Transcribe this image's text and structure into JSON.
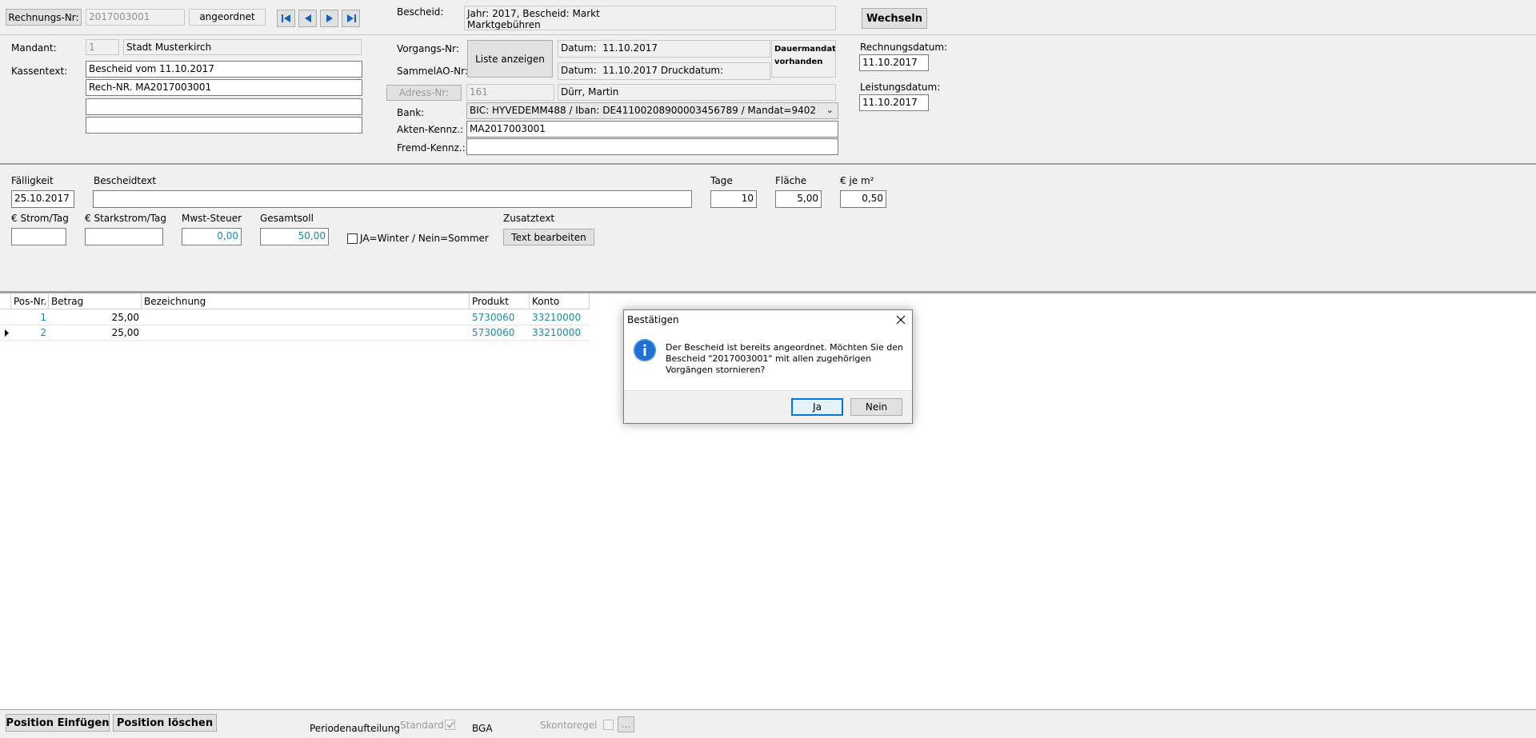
{
  "header": {
    "rechnungs_nr_button": "Rechnungs-Nr:",
    "rechnungs_nr_value": "2017003001",
    "status": "angeordnet",
    "bescheid_label": "Bescheid:",
    "bescheid_line1": "Jahr: 2017, Bescheid: Markt",
    "bescheid_line2": "Marktgebühren",
    "wechseln_button": "Wechseln"
  },
  "nav_icons": [
    "first-record-icon",
    "previous-record-icon",
    "next-record-icon",
    "last-record-icon"
  ],
  "left": {
    "mandant_label": "Mandant:",
    "mandant_nr": "1",
    "mandant_name": "Stadt Musterkirch",
    "kassentext_label": "Kassentext:",
    "kassentext_lines": [
      "Bescheid vom 11.10.2017",
      "Rech-NR. MA2017003001",
      "",
      ""
    ]
  },
  "middle": {
    "vorgangs_nr_label": "Vorgangs-Nr:",
    "sammelao_nr_label": "SammelAO-Nr:",
    "liste_anzeigen_button": "Liste anzeigen",
    "datum1_label": "Datum:",
    "datum1_value": "11.10.2017",
    "datum2_label": "Datum:",
    "datum2_value": "11.10.2017",
    "druckdatum_label": "Druckdatum:",
    "dauermandat_line1": "Dauermandat",
    "dauermandat_line2": "vorhanden",
    "adress_nr_button": "Adress-Nr:",
    "adress_nr_value": "161",
    "adress_name": "Dürr, Martin",
    "bank_label": "Bank:",
    "bank_value": "BIC: HYVEDEMM488 / Iban: DE41100208900003456789 /   Mandat=9402",
    "akten_label": "Akten-Kennz.:",
    "akten_value": "MA2017003001",
    "fremd_label": "Fremd-Kennz.:",
    "fremd_value": ""
  },
  "right": {
    "rechnungsdatum_label": "Rechnungsdatum:",
    "rechnungsdatum_value": "11.10.2017",
    "leistungsdatum_label": "Leistungsdatum:",
    "leistungsdatum_value": "11.10.2017"
  },
  "details": {
    "faelligkeit_label": "Fälligkeit",
    "faelligkeit_value": "25.10.2017",
    "bescheidtext_label": "Bescheidtext",
    "bescheidtext_value": "",
    "tage_label": "Tage",
    "tage_value": "10",
    "flaeche_label": "Fläche",
    "flaeche_value": "5,00",
    "eur_je_m2_label": "€ je m²",
    "eur_je_m2_value": "0,50",
    "strom_label": "€ Strom/Tag",
    "strom_value": "",
    "starkstrom_label": "€ Starkstrom/Tag",
    "starkstrom_value": "",
    "mwst_label": "Mwst-Steuer",
    "mwst_value": "0,00",
    "gesamtsoll_label": "Gesamtsoll",
    "gesamtsoll_value": "50,00",
    "winter_label": "JA=Winter / Nein=Sommer",
    "winter_checked": false,
    "zusatztext_label": "Zusatztext",
    "text_bearbeiten_button": "Text bearbeiten"
  },
  "grid": {
    "columns": [
      "Pos-Nr.",
      "Betrag",
      "Bezeichnung",
      "Produkt",
      "Konto"
    ],
    "rows": [
      {
        "pos": "1",
        "betrag": "25,00",
        "bezeichnung": "",
        "produkt": "5730060",
        "konto": "33210000"
      },
      {
        "pos": "2",
        "betrag": "25,00",
        "bezeichnung": "",
        "produkt": "5730060",
        "konto": "33210000"
      }
    ],
    "current_row": 2
  },
  "footer": {
    "position_einfuegen": "Position Einfügen",
    "position_loeschen": "Position löschen",
    "periodenaufteilung_label": "Periodenaufteilung",
    "standard_label": "Standard",
    "standard_checked": true,
    "bga_label": "BGA",
    "skontoregel_label": "Skontoregel",
    "skontoregel_checked": false,
    "ellipsis_button": "..."
  },
  "dialog": {
    "title": "Bestätigen",
    "message": "Der Bescheid ist bereits angeordnet. Möchten Sie den Bescheid \"2017003001\" mit allen zugehörigen Vorgängen stornieren?",
    "yes": "Ja",
    "no": "Nein",
    "icon": "info-icon"
  },
  "colors": {
    "window_bg": "#f0f0f0",
    "teal_values": "#1a8aa0",
    "info_blue": "#1e6fd0"
  }
}
